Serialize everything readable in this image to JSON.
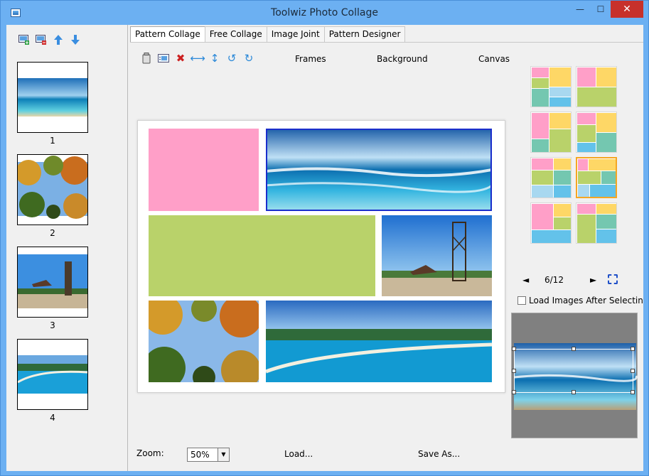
{
  "window": {
    "title": "Toolwiz Photo Collage",
    "minimize": "—",
    "maximize": "☐",
    "close": "✕"
  },
  "thumbnails": [
    {
      "label": "1"
    },
    {
      "label": "2"
    },
    {
      "label": "3"
    },
    {
      "label": "4"
    }
  ],
  "tabs": [
    {
      "label": "Pattern Collage"
    },
    {
      "label": "Free Collage"
    },
    {
      "label": "Image Joint"
    },
    {
      "label": "Pattern Designer"
    }
  ],
  "menu": {
    "frames": "Frames",
    "background": "Background",
    "canvas": "Canvas"
  },
  "pager": {
    "prev": "◄",
    "text": "6/12",
    "next": "►"
  },
  "load_after_select": "Load Images After Selectin",
  "zoom": {
    "label": "Zoom:",
    "value": "50%"
  },
  "buttons": {
    "load": "Load...",
    "save_as": "Save As..."
  },
  "colors": {
    "pink": "#ff9fc8",
    "yellow": "#fed766",
    "green": "#b9d26a",
    "teal": "#74c7b0",
    "blue": "#63c2ea",
    "selection": "#1a2ecc",
    "pattern_selected": "#f5a623"
  }
}
